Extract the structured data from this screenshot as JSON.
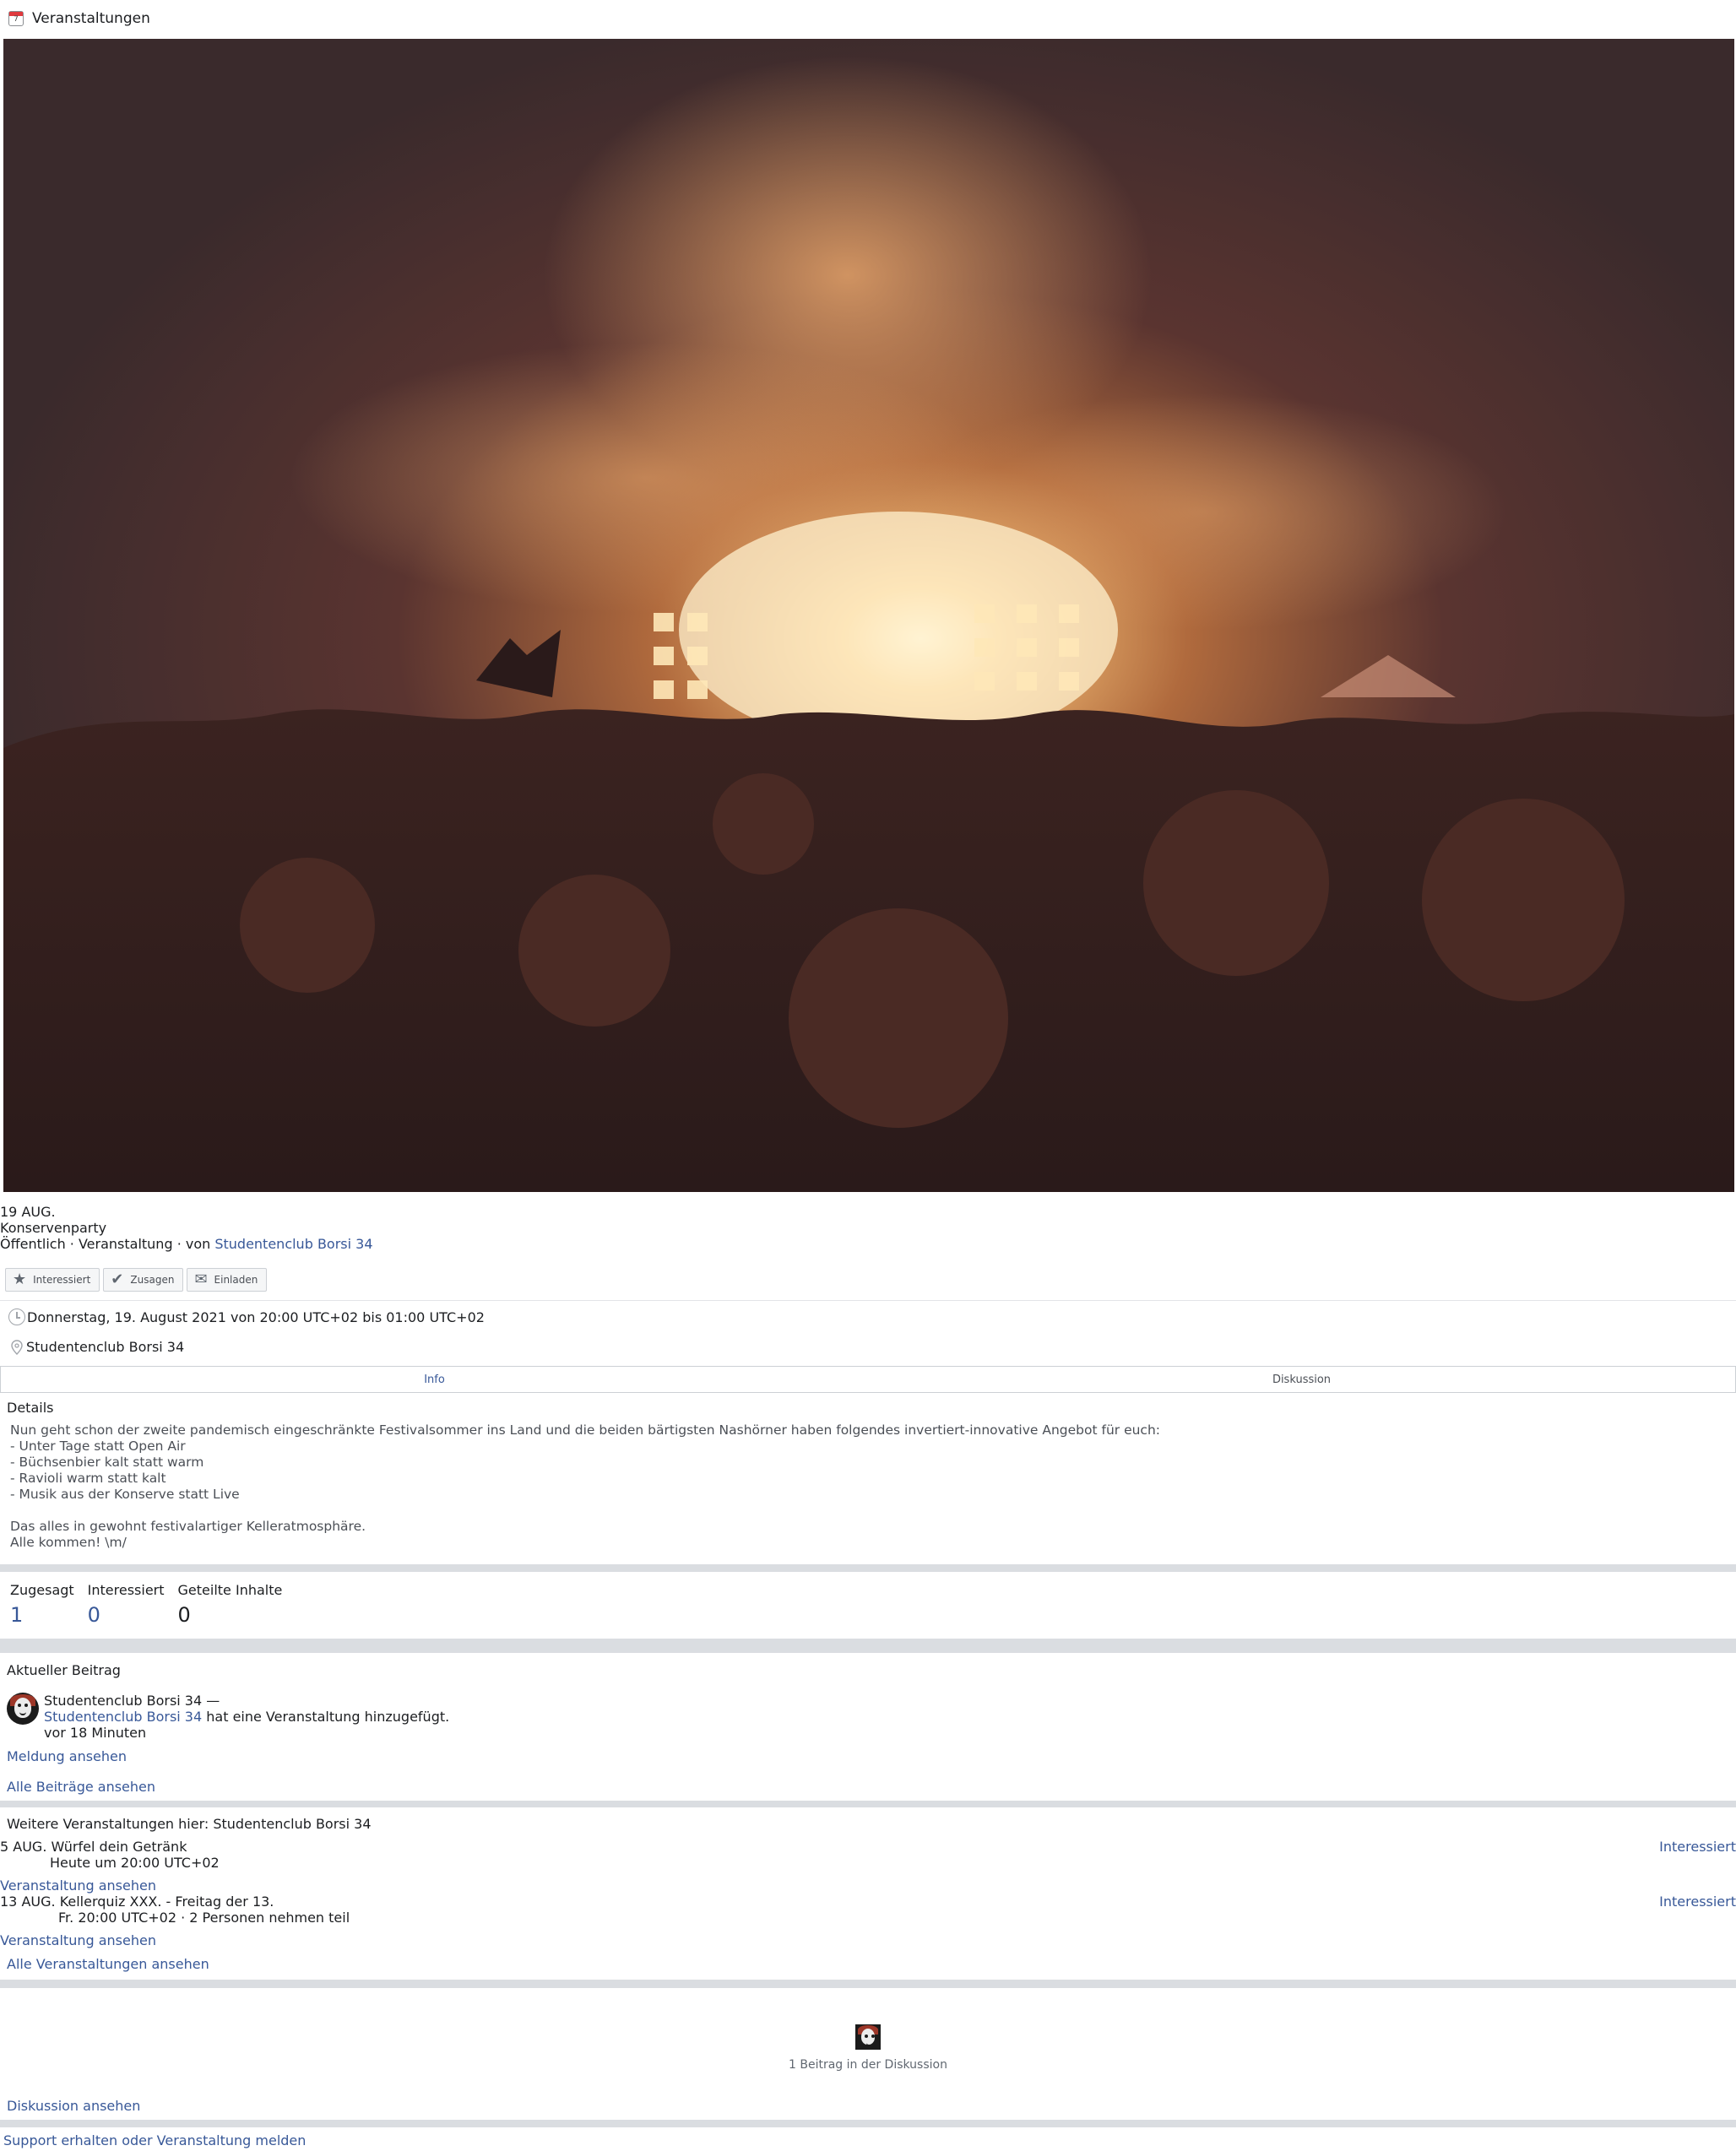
{
  "topbar": {
    "title": "Veranstaltungen"
  },
  "event": {
    "date_badge": "19 AUG.",
    "name": "Konservenparty",
    "meta_prefix": "Öffentlich · Veranstaltung · von ",
    "host": "Studentenclub Borsi 34",
    "cover_alt": "Konzert-Menge vor einer leuchtenden Festivalbühne"
  },
  "actions": [
    {
      "label": "Interessiert",
      "icon": "star-icon"
    },
    {
      "label": "Zusagen",
      "icon": "check-icon"
    },
    {
      "label": "Einladen",
      "icon": "envelope-icon"
    }
  ],
  "info": {
    "datetime": "Donnerstag, 19. August 2021 von 20:00 UTC+02 bis 01:00 UTC+02",
    "location": "Studentenclub Borsi 34"
  },
  "tabs": [
    {
      "label": "Info",
      "active": true
    },
    {
      "label": "Diskussion",
      "active": false
    }
  ],
  "details": {
    "title": "Details",
    "body": "Nun geht schon der zweite pandemisch eingeschränkte Festivalsommer ins Land und die beiden bärtigsten Nashörner haben folgendes invertiert-innovative Angebot für euch:\n- Unter Tage statt Open Air\n- Büchsenbier kalt statt warm\n- Ravioli warm statt kalt\n- Musik aus der Konserve statt Live\n\nDas alles in gewohnt festivalartiger Kelleratmosphäre.\nAlle kommen! \\m/"
  },
  "stats": [
    {
      "label": "Zugesagt",
      "value": "1"
    },
    {
      "label": "Interessiert",
      "value": "0"
    },
    {
      "label": "Geteilte Inhalte",
      "value": "0"
    }
  ],
  "recent_post": {
    "title": "Aktueller Beitrag",
    "author_line": "Studentenclub Borsi 34 —",
    "actor": "Studentenclub Borsi 34",
    "action": " hat eine Veranstaltung hinzugefügt.",
    "time": "vor 18 Minuten",
    "view_link": "Meldung ansehen",
    "all_link": "Alle Beiträge ansehen"
  },
  "more_events": {
    "title": "Weitere Veranstaltungen hier: Studentenclub Borsi 34",
    "items": [
      {
        "date": "5 AUG.",
        "name": "Würfel dein Getränk",
        "when": "Heute um 20:00 UTC+02",
        "interest": "Interessiert",
        "view": "Veranstaltung ansehen"
      },
      {
        "date": "13 AUG.",
        "name": "Kellerquiz XXX. - Freitag der 13.",
        "when": "Fr. 20:00 UTC+02 · 2 Personen nehmen teil",
        "interest": "Interessiert",
        "view": "Veranstaltung ansehen"
      }
    ],
    "all_link": "Alle Veranstaltungen ansehen"
  },
  "discussion": {
    "count": "1 Beitrag in der Diskussion",
    "link": "Diskussion ansehen"
  },
  "footer": {
    "support": "Support erhalten oder Veranstaltung melden"
  },
  "colors": {
    "link": "#385898",
    "divider": "#dadde1",
    "cover_glow": "#f7c27a"
  }
}
